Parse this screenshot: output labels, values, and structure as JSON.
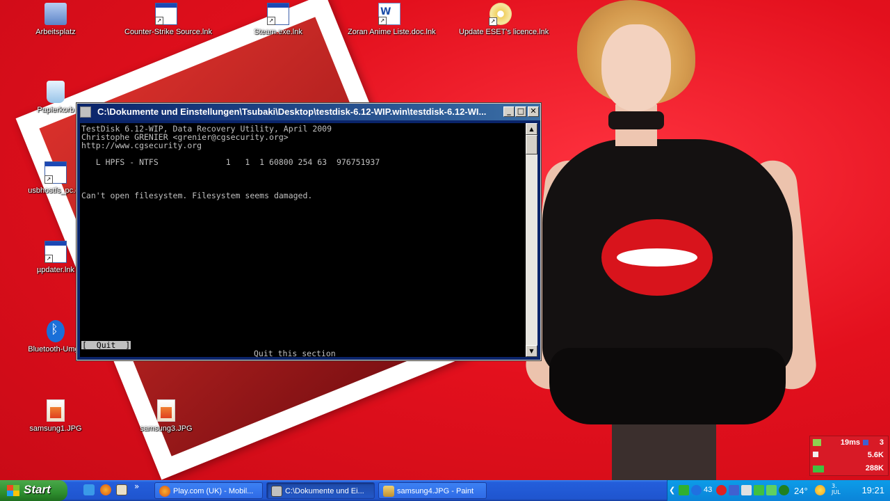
{
  "desktop": {
    "icons": [
      {
        "label": "Arbeitsplatz",
        "icon": "my-computer-icon"
      },
      {
        "label": "Counter-Strike Source.lnk",
        "icon": "shortcut-icon"
      },
      {
        "label": "Steam.exe.lnk",
        "icon": "shortcut-icon"
      },
      {
        "label": "Zoran Anime Liste.doc.lnk",
        "icon": "word-document-icon"
      },
      {
        "label": "Update ESET's licence.lnk",
        "icon": "cd-icon"
      },
      {
        "label": "Papierkorb",
        "icon": "recycle-bin-icon"
      },
      {
        "label": "usbhostfs_pc.ex",
        "icon": "application-icon"
      },
      {
        "label": "µpdater.lnk",
        "icon": "application-icon"
      },
      {
        "label": "Bluetooth-Umge",
        "icon": "bluetooth-icon"
      },
      {
        "label": "samsung1.JPG",
        "icon": "jpg-image-icon"
      },
      {
        "label": "samsung3.JPG",
        "icon": "jpg-image-icon"
      }
    ]
  },
  "console_window": {
    "title": "C:\\Dokumente und Einstellungen\\Tsubaki\\Desktop\\testdisk-6.12-WIP.win\\testdisk-6.12-WI...",
    "lines": [
      "TestDisk 6.12-WIP, Data Recovery Utility, April 2009",
      "Christophe GRENIER <grenier@cgsecurity.org>",
      "http://www.cgsecurity.org",
      "   L HPFS - NTFS              1   1  1 60800 254 63  976751937",
      "Can't open filesystem. Filesystem seems damaged."
    ],
    "quit_button": "[  Quit  ]",
    "status": "Quit this section",
    "buttons": {
      "minimize": "_",
      "maximize": "□",
      "close": "✕"
    }
  },
  "monitor_widget": {
    "ping": "19ms",
    "count": "3",
    "upload": "5.6K",
    "download": "288K"
  },
  "taskbar": {
    "start_label": "Start",
    "quick_launch": [
      "internet-explorer-icon",
      "firefox-icon",
      "show-desktop-icon"
    ],
    "overflow": "»",
    "tasks": [
      {
        "label": "Play.com (UK) - Mobil...",
        "icon": "firefox-icon"
      },
      {
        "label": "C:\\Dokumente und Ei...",
        "icon": "console-icon"
      },
      {
        "label": "samsung4.JPG - Paint",
        "icon": "paint-icon"
      }
    ],
    "tray": {
      "temp": "43",
      "weather_temp": "24°",
      "date_day": "3.",
      "date_month": "JUL",
      "clock": "19:21"
    }
  },
  "colors": {
    "wallpaper_red": "#e0101c",
    "console_bg": "#000000",
    "console_fg": "#c0c0c0",
    "titlebar": "#0a246a",
    "taskbar_blue": "#245edb",
    "start_green": "#2f8f2f"
  }
}
